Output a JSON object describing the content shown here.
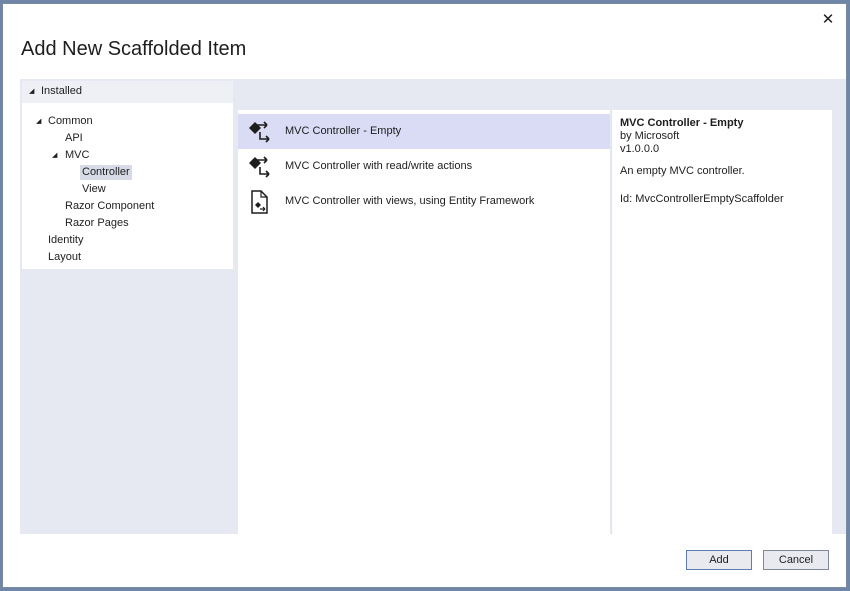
{
  "dialog": {
    "title": "Add New Scaffolded Item",
    "close_glyph": "✕"
  },
  "tree": {
    "root": "Installed",
    "items": [
      {
        "label": "Common"
      },
      {
        "label": "API"
      },
      {
        "label": "MVC"
      },
      {
        "label": "Controller"
      },
      {
        "label": "View"
      },
      {
        "label": "Razor Component"
      },
      {
        "label": "Razor Pages"
      },
      {
        "label": "Identity"
      },
      {
        "label": "Layout"
      }
    ],
    "selected": "Controller"
  },
  "templates": [
    {
      "label": "MVC Controller - Empty",
      "icon": "controller-icon",
      "selected": true
    },
    {
      "label": "MVC Controller with read/write actions",
      "icon": "controller-icon",
      "selected": false
    },
    {
      "label": "MVC Controller with views, using Entity Framework",
      "icon": "file-controller-icon",
      "selected": false
    }
  ],
  "details": {
    "title": "MVC Controller - Empty",
    "author": "by Microsoft",
    "version": "v1.0.0.0",
    "description": "An empty MVC controller.",
    "id": "Id: MvcControllerEmptyScaffolder"
  },
  "buttons": {
    "add": "Add",
    "cancel": "Cancel"
  },
  "colors": {
    "selected_template": "#d9dcf4",
    "panel_background": "#e6e9f2",
    "selected_tree": "#d7dbe8"
  }
}
